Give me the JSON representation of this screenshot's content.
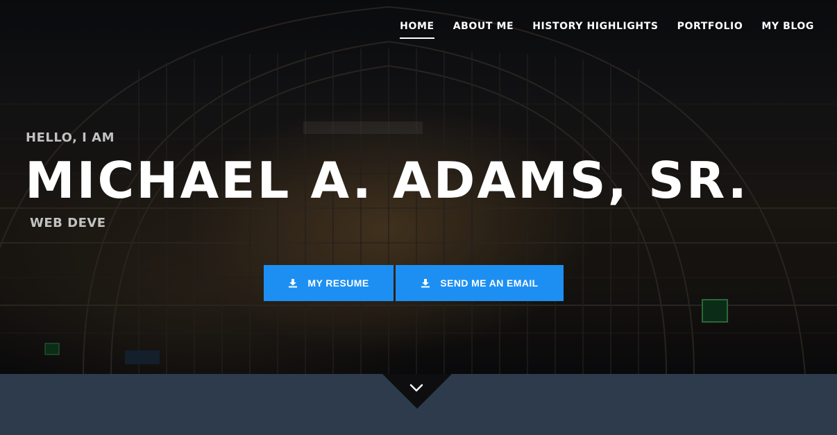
{
  "nav": {
    "items": [
      {
        "label": "HOME",
        "active": true
      },
      {
        "label": "ABOUT ME",
        "active": false
      },
      {
        "label": "HISTORY HIGHLIGHTS",
        "active": false
      },
      {
        "label": "PORTFOLIO",
        "active": false
      },
      {
        "label": "MY BLOG",
        "active": false
      }
    ]
  },
  "hero": {
    "greeting": "HELLO, I AM",
    "name": "MICHAEL A. ADAMS, SR.",
    "role": "WEB DEVE",
    "buttons": {
      "resume_label": "MY RESUME",
      "email_label": "SEND ME AN EMAIL"
    }
  },
  "icons": {
    "resume": "download-icon",
    "email": "download-icon",
    "scroll": "chevron-down-icon"
  },
  "colors": {
    "accent": "#1e8ff2",
    "bottom_band": "#2d3b4d",
    "text_primary": "#ffffff",
    "text_muted": "#c2c2c2"
  }
}
